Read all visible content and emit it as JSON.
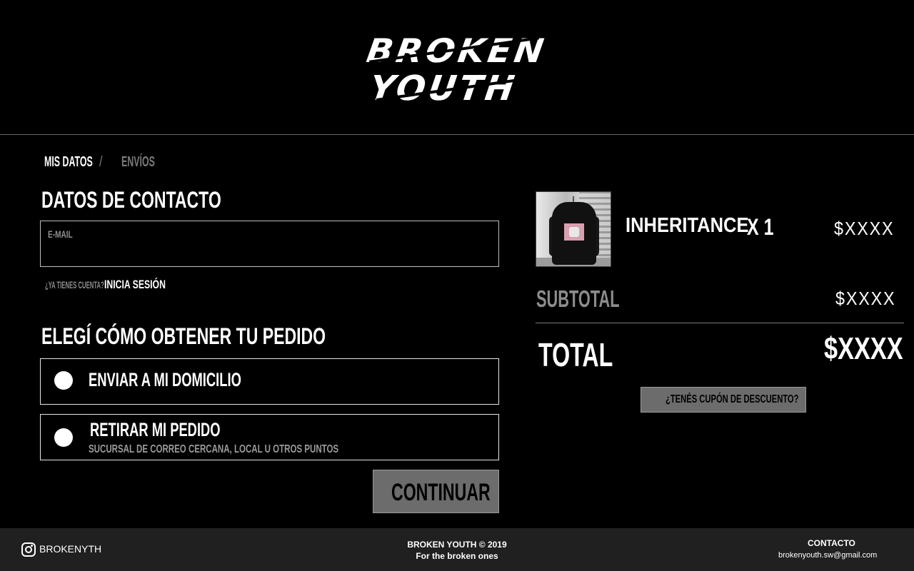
{
  "brand": {
    "logo_line1": "BROKEN",
    "logo_line2": "YOUTH"
  },
  "breadcrumb": {
    "step1": "MIS DATOS",
    "separator": "/",
    "step2": "ENVÍOS"
  },
  "contact": {
    "heading": "DATOS DE CONTACTO",
    "email_label": "E-MAIL",
    "email_value": "",
    "account_question": "¿YA TIENES CUENTA?",
    "login_link": "INICIA SESIÓN"
  },
  "delivery": {
    "heading": "ELEGÍ CÓMO OBTENER TU PEDIDO",
    "options": [
      {
        "label": "ENVIAR A MI DOMICILIO",
        "sublabel": ""
      },
      {
        "label": "RETIRAR MI PEDIDO",
        "sublabel": "SUCURSAL DE CORREO CERCANA, LOCAL U OTROS PUNTOS"
      }
    ],
    "continue_label": "CONTINUAR"
  },
  "cart": {
    "items": [
      {
        "name": "INHERITANCE",
        "qty": "X 1",
        "price": "$XXXX"
      }
    ],
    "subtotal_label": "SUBTOTAL",
    "subtotal_value": "$XXXX",
    "total_label": "TOTAL",
    "total_value": "$XXXX",
    "coupon_label": "¿TENÉS CUPÓN DE DESCUENTO?"
  },
  "footer": {
    "instagram_handle": "BROKENYTH",
    "copyright": "BROKEN YOUTH © 2019",
    "tagline": "For the broken ones",
    "contact_title": "CONTACTO",
    "contact_email": "brokenyouth.sw@gmail.com"
  },
  "colors": {
    "background": "#000000",
    "footer_bg": "#202020",
    "button_gray": "#6c6c6c",
    "muted_text": "#8c8c8c"
  },
  "icons": {
    "footer_social": "instagram-icon",
    "radio": "radio-unselected-icon"
  }
}
